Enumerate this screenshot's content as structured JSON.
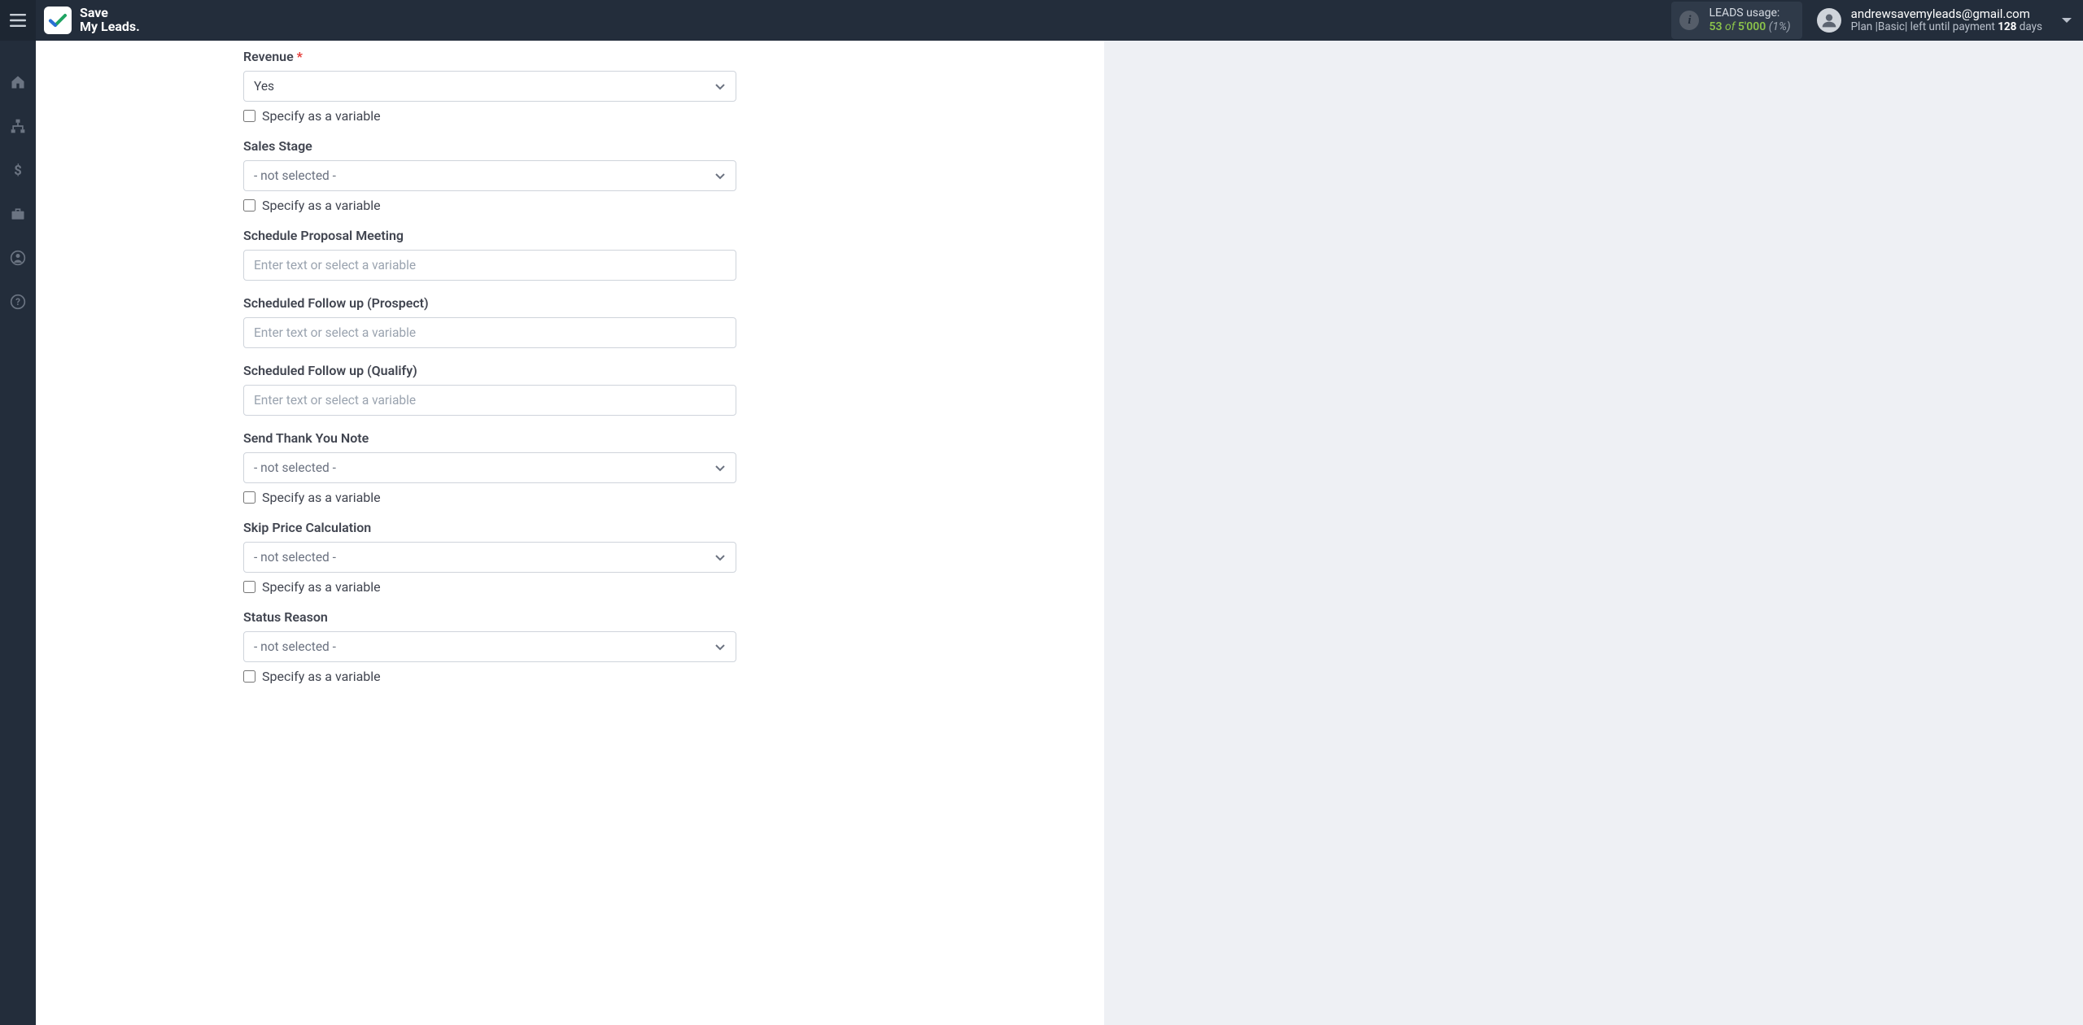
{
  "header": {
    "brand_line1": "Save",
    "brand_line2": "My Leads.",
    "usage_label": "LEADS usage:",
    "usage_used": "53",
    "usage_of": "of",
    "usage_total": "5'000",
    "usage_pct": "(1%)",
    "account_email": "andrewsavemyleads@gmail.com",
    "plan_prefix": "Plan |",
    "plan_name": "Basic",
    "plan_mid": "| left until payment ",
    "plan_days_num": "128",
    "plan_days_word": " days"
  },
  "form": {
    "variable_label": "Specify as a variable",
    "not_selected": "- not selected -",
    "text_placeholder": "Enter text or select a variable",
    "fields": {
      "revenue": {
        "label": "Revenue",
        "value": "Yes",
        "required": true
      },
      "sales_stage": {
        "label": "Sales Stage"
      },
      "schedule_proposal": {
        "label": "Schedule Proposal Meeting"
      },
      "followup_prospect": {
        "label": "Scheduled Follow up (Prospect)"
      },
      "followup_qualify": {
        "label": "Scheduled Follow up (Qualify)"
      },
      "thank_you": {
        "label": "Send Thank You Note"
      },
      "skip_price": {
        "label": "Skip Price Calculation"
      },
      "status_reason": {
        "label": "Status Reason"
      }
    }
  }
}
